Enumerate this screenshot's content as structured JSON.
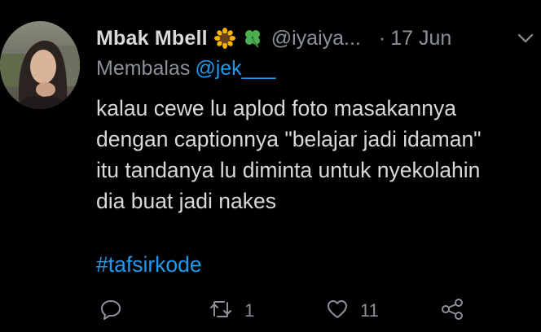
{
  "tweet": {
    "display_name": "Mbak Mbell",
    "emojis": [
      "sunflower-emoji",
      "four-leaf-clover-emoji"
    ],
    "handle": "@iyaiya...",
    "dot": "·",
    "date": "17 Jun",
    "reply_prefix": "Membalas",
    "reply_mention": "@jek___",
    "body_lines": [
      "kalau cewe lu aplod foto masakannya",
      "dengan captionnya \"belajar jadi idaman\"",
      "itu tandanya lu diminta untuk nyekolahin",
      "dia buat jadi nakes"
    ],
    "hashtag": "#tafsirkode",
    "actions": {
      "reply_count": "",
      "retweet_count": "1",
      "like_count": "11"
    }
  },
  "colors": {
    "background": "#000000",
    "text_primary": "#d9d9d9",
    "text_secondary": "#8b9198",
    "link": "#1d9bf0"
  },
  "icons": {
    "reply": "reply-icon",
    "retweet": "retweet-icon",
    "like": "heart-icon",
    "share": "share-icon",
    "more": "chevron-down-icon"
  }
}
